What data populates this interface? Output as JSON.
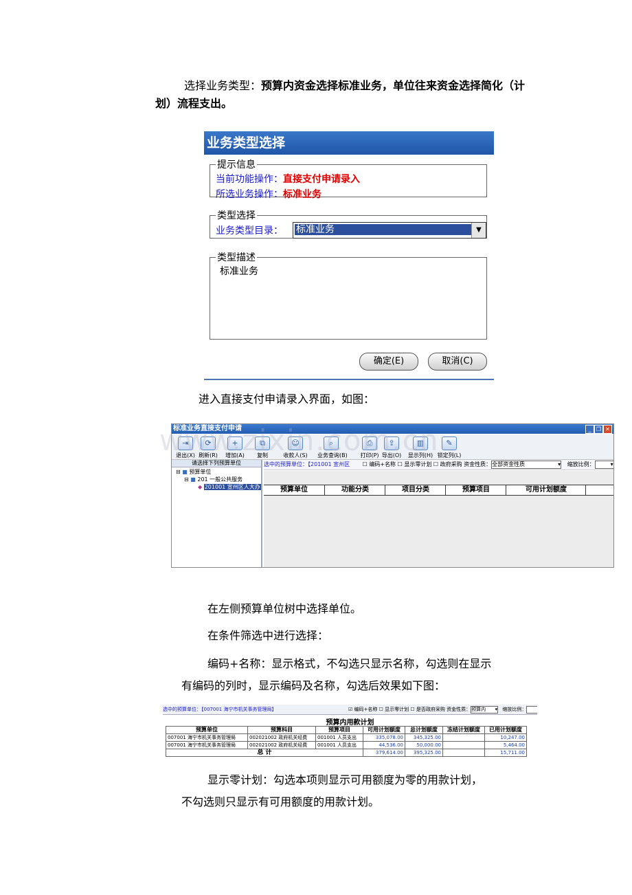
{
  "paragraphs": {
    "p1_label": "选择业务类型：",
    "p1_bold_line1": "预算内资金选择标准业务，单位往来资金选择简化（计",
    "p1_bold_line2": "划）流程支出。",
    "p2": "进入直接支付申请录入界面，如图：",
    "p3": "在左侧预算单位树中选择单位。",
    "p4": "在条件筛选中进行选择：",
    "p5_line1": "编码+名称：显示格式，不勾选只显示名称，勾选则在显示",
    "p5_line2": "有编码的列时，显示编码及名称，勾选后效果如下图：",
    "p6_line1": "显示零计划：勾选本项则显示可用额度为零的用款计划，",
    "p6_line2": "不勾选则只显示有可用额度的用款计划。"
  },
  "dialog": {
    "title": "业务类型选择",
    "group1_legend": "提示信息",
    "cur_op_label": "当前功能操作：",
    "cur_op_value": "直接支付申请录入",
    "sel_op_label": "所选业务操作：",
    "sel_op_value": "标准业务",
    "group2_legend": "类型选择",
    "catalog_label": "业务类型目录：",
    "catalog_value": "标准业务",
    "group3_legend": "类型描述",
    "desc_text": "标准业务",
    "ok_label": "确定(E)",
    "cancel_label": "取消(C)"
  },
  "window": {
    "title": "标准业务直接支付申请",
    "toolbar": [
      {
        "label": "退出(X)",
        "icon": "exit-icon"
      },
      {
        "label": "刷新(R)",
        "icon": "refresh-icon"
      },
      {
        "label": "增加(A)",
        "icon": "add-icon"
      },
      {
        "label": "复制",
        "icon": "copy-icon"
      },
      {
        "label": "收款人(S)",
        "icon": "payee-icon"
      },
      {
        "label": "业务查询(B)",
        "icon": "query-icon"
      },
      {
        "label": "打印(P)",
        "icon": "print-icon"
      },
      {
        "label": "导出(O)",
        "icon": "export-icon"
      },
      {
        "label": "显示列(H)",
        "icon": "columns-icon"
      },
      {
        "label": "锁定列(L)",
        "icon": "lock-column-icon"
      }
    ],
    "left_header": "请选择下列预算单位",
    "tree": [
      "预算单位",
      "201  一般公共服务",
      "201001 宣州区人大办"
    ],
    "filter": {
      "selected_unit": "选中的预算单位：【201001 宣州区",
      "opt1": "编码+名称",
      "opt2": "显示零计划",
      "opt3": "政府采购",
      "fund_label": "资金性质：",
      "fund_value": "全部资金性质",
      "zoom_label": "缩放比例："
    },
    "columns": [
      "预算单位",
      "功能分类",
      "项目分类",
      "预算项目",
      "可用计划额度"
    ]
  },
  "table3": {
    "filter_unit": "选中的预算单位：【007001 海宁市机关事务管理局】",
    "opt1": "编码+名称",
    "opt2": "显示零计划",
    "opt3": "是否政府采购",
    "fund_label": "资金性质：",
    "fund_value": "预算内",
    "zoom_label": "缩放比例：",
    "title": "预算内用款计划",
    "headers": [
      "预算单位",
      "预算科目",
      "预算项目",
      "可用计划额度",
      "总计划额度",
      "冻结计划额度",
      "已用计划额度"
    ],
    "rows": [
      [
        "007001 海宁市机关事务管理局",
        "002021002 政府机关经费",
        "001001 人员支出",
        "335,078.00",
        "345,325.00",
        "",
        "10,247.00"
      ],
      [
        "007001 海宁市机关事务管理局",
        "002021002 政府机关经费",
        "001001 人员支出",
        "44,536.00",
        "50,000.00",
        "",
        "5,464.00"
      ]
    ],
    "total_label": "总    计",
    "total": [
      "379,614.00",
      "395,325.00",
      "",
      "15,711.00"
    ]
  },
  "watermark": "www.zixin.com.cn"
}
